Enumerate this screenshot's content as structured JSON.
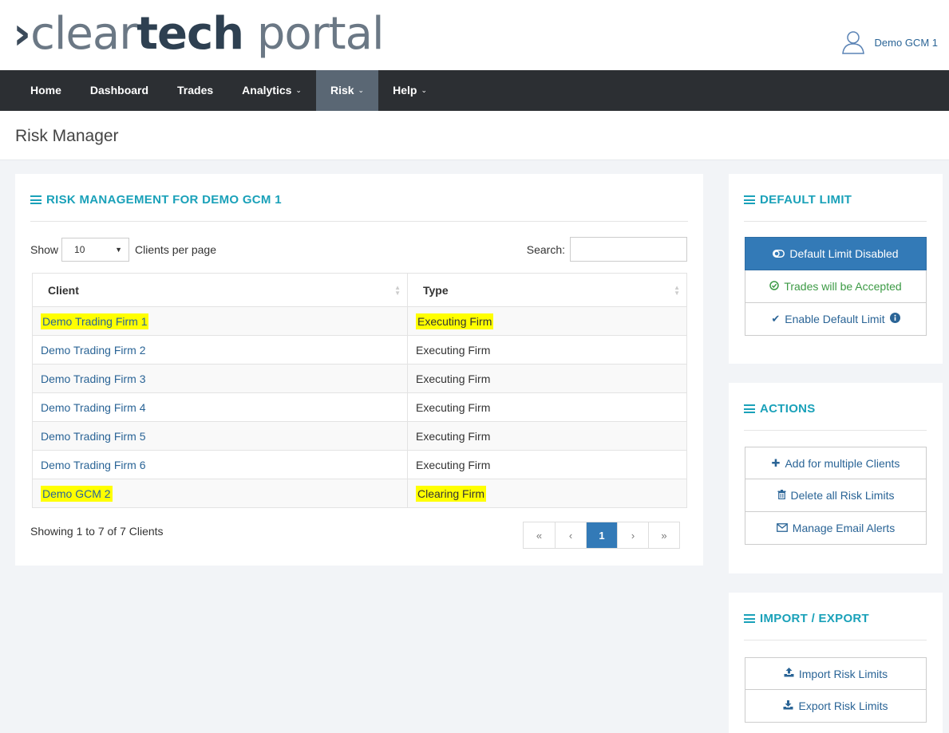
{
  "header": {
    "logo_chevron": "›",
    "logo_light": "clear",
    "logo_bold": "tech",
    "logo_portal": " portal",
    "user_name": "Demo GCM 1"
  },
  "nav": [
    {
      "label": "Home",
      "dropdown": false
    },
    {
      "label": "Dashboard",
      "dropdown": false
    },
    {
      "label": "Trades",
      "dropdown": false
    },
    {
      "label": "Analytics",
      "dropdown": true
    },
    {
      "label": "Risk",
      "dropdown": true,
      "active": true
    },
    {
      "label": "Help",
      "dropdown": true
    }
  ],
  "page_title": "Risk Manager",
  "main": {
    "heading": "RISK MANAGEMENT FOR DEMO GCM 1",
    "show_label": "Show",
    "page_size": "10",
    "per_page_label": "Clients per page",
    "search_label": "Search:",
    "search_value": "",
    "columns": [
      "Client",
      "Type"
    ],
    "rows": [
      {
        "client": "Demo Trading Firm 1",
        "type": "Executing Firm",
        "highlight": true
      },
      {
        "client": "Demo Trading Firm 2",
        "type": "Executing Firm",
        "highlight": false
      },
      {
        "client": "Demo Trading Firm 3",
        "type": "Executing Firm",
        "highlight": false
      },
      {
        "client": "Demo Trading Firm 4",
        "type": "Executing Firm",
        "highlight": false
      },
      {
        "client": "Demo Trading Firm 5",
        "type": "Executing Firm",
        "highlight": false
      },
      {
        "client": "Demo Trading Firm 6",
        "type": "Executing Firm",
        "highlight": false
      },
      {
        "client": "Demo GCM 2",
        "type": "Clearing Firm",
        "highlight": true
      }
    ],
    "showing_text": "Showing 1 to 7 of 7 Clients",
    "pager": {
      "first": "«",
      "prev": "‹",
      "current": "1",
      "next": "›",
      "last": "»"
    }
  },
  "default_limit": {
    "heading": "DEFAULT LIMIT",
    "status_button": "Default Limit Disabled",
    "accepted_text": "Trades will be Accepted",
    "enable_button": "Enable Default Limit"
  },
  "actions": {
    "heading": "ACTIONS",
    "add_button": "Add for multiple Clients",
    "delete_button": "Delete all Risk Limits",
    "email_button": "Manage Email Alerts"
  },
  "import_export": {
    "heading": "IMPORT / EXPORT",
    "import_button": "Import Risk Limits",
    "export_button": "Export Risk Limits"
  },
  "colors": {
    "accent": "#1aa1b9",
    "nav_bg": "#2c2f33",
    "nav_active": "#5a6774",
    "primary": "#337ab7",
    "link": "#2a6496",
    "highlight": "#ffff00",
    "success": "#3c9a45"
  }
}
